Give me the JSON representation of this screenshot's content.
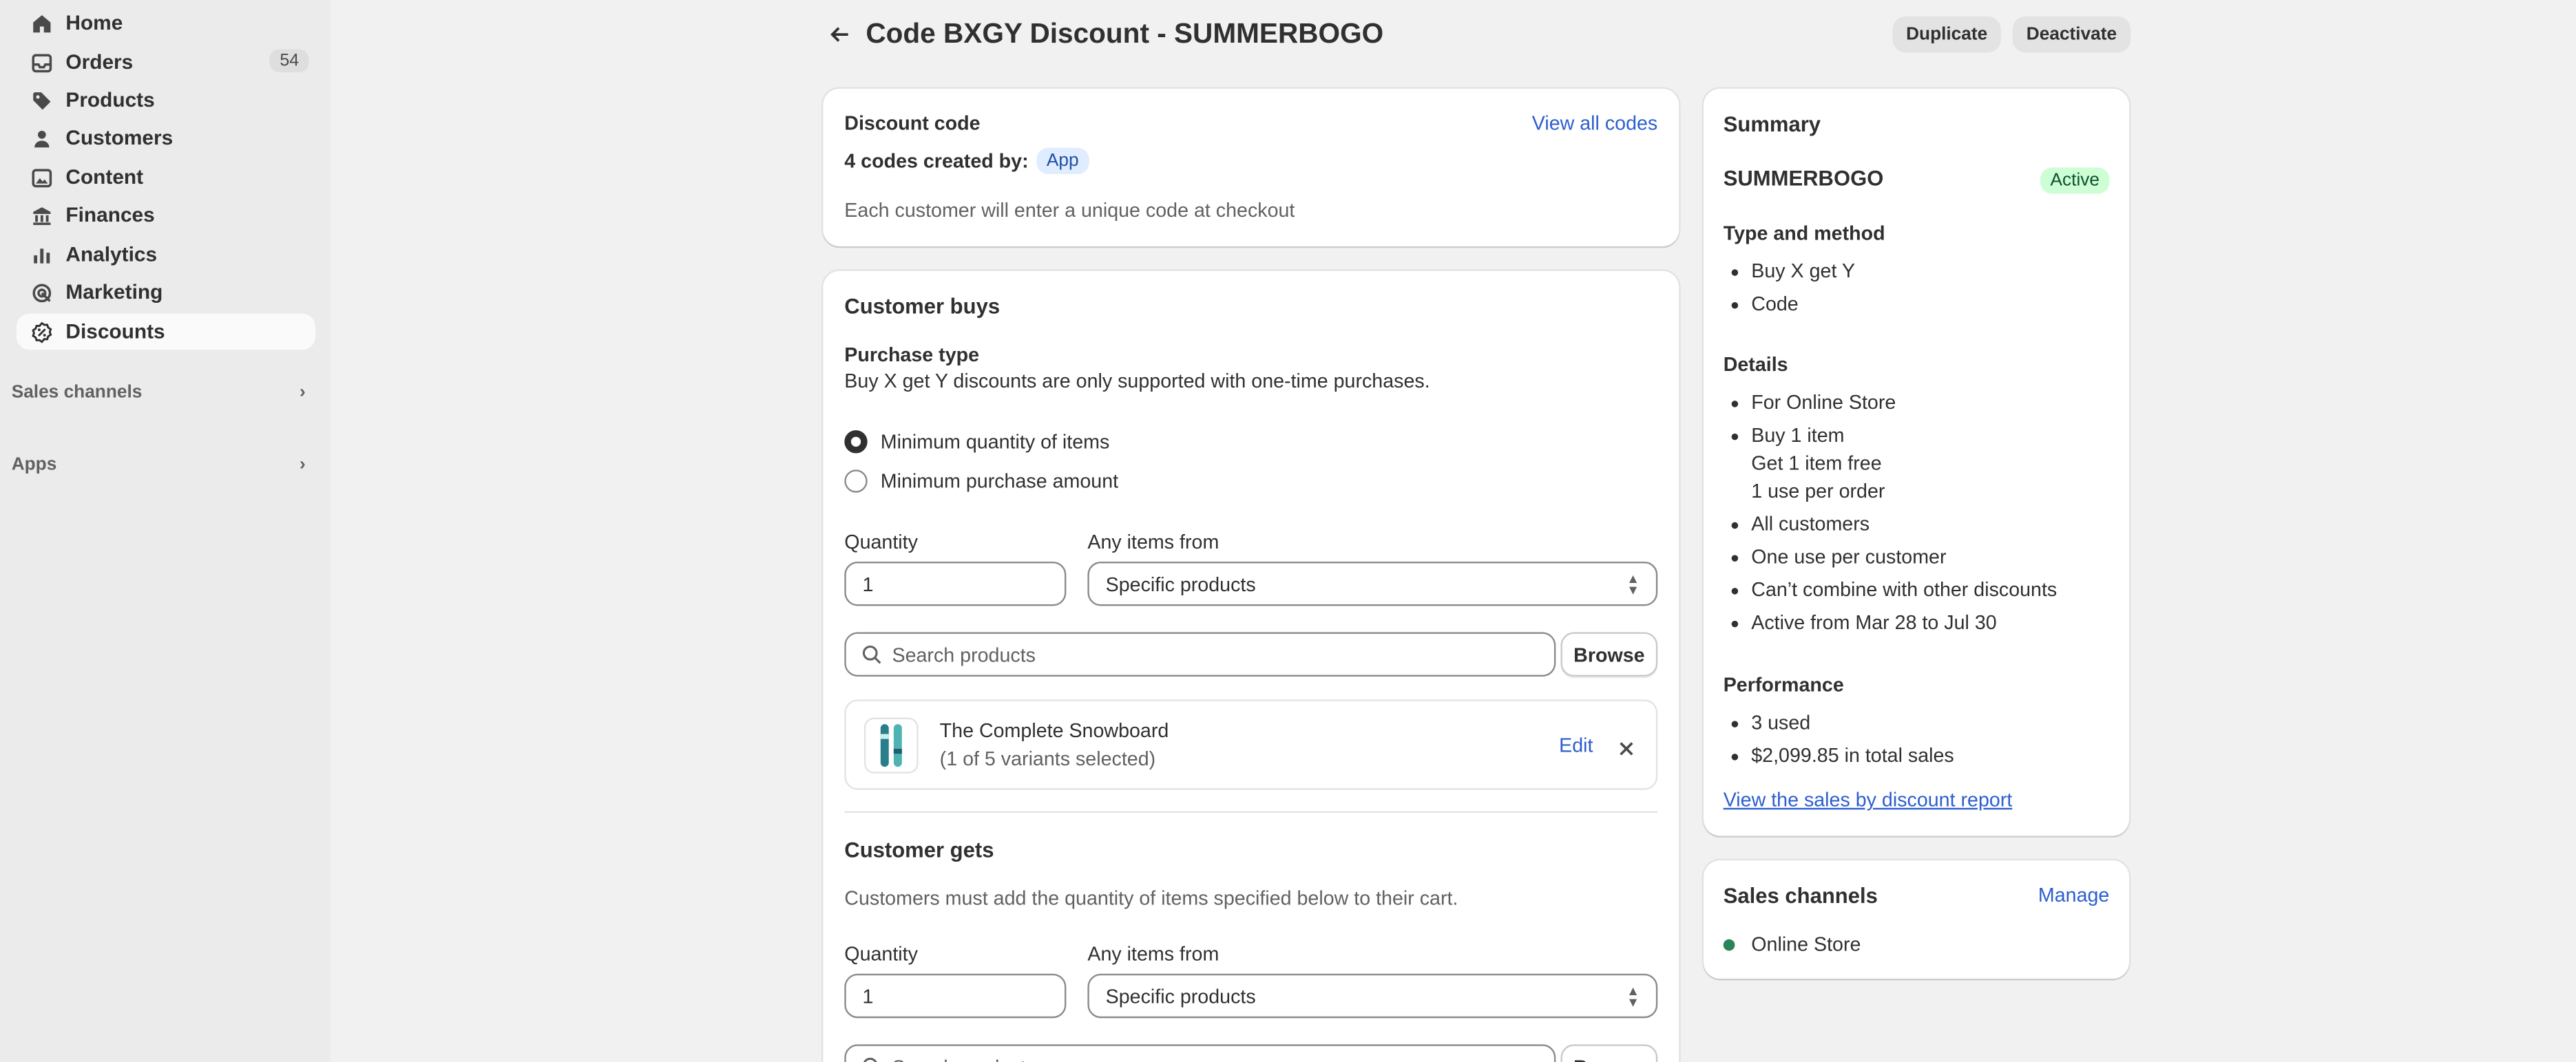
{
  "sidebar": {
    "items": [
      {
        "label": "Home",
        "icon": "home-icon"
      },
      {
        "label": "Orders",
        "icon": "inbox-icon",
        "badge": "54"
      },
      {
        "label": "Products",
        "icon": "tag-icon"
      },
      {
        "label": "Customers",
        "icon": "person-icon"
      },
      {
        "label": "Content",
        "icon": "image-icon"
      },
      {
        "label": "Finances",
        "icon": "bank-icon"
      },
      {
        "label": "Analytics",
        "icon": "bar-chart-icon"
      },
      {
        "label": "Marketing",
        "icon": "target-icon"
      },
      {
        "label": "Discounts",
        "icon": "discount-icon",
        "active": true
      }
    ],
    "sections": [
      {
        "label": "Sales channels"
      },
      {
        "label": "Apps"
      }
    ]
  },
  "header": {
    "title": "Code BXGY Discount - SUMMERBOGO",
    "duplicate_label": "Duplicate",
    "deactivate_label": "Deactivate"
  },
  "discount_code": {
    "title": "Discount code",
    "view_all_label": "View all codes",
    "codes_created": "4 codes created by:",
    "created_by": "App",
    "note": "Each customer will enter a unique code at checkout"
  },
  "customer_buys": {
    "title": "Customer buys",
    "purchase_type_label": "Purchase type",
    "purchase_type_note": "Buy X get Y discounts are only supported with one-time purchases.",
    "radio_min_qty": "Minimum quantity of items",
    "radio_min_amount": "Minimum purchase amount",
    "quantity_label": "Quantity",
    "quantity_value": "1",
    "any_items_label": "Any items from",
    "any_items_value": "Specific products",
    "search_placeholder": "Search products",
    "browse_label": "Browse",
    "product_name": "The Complete Snowboard",
    "product_variants": "(1 of 5 variants selected)",
    "edit_label": "Edit"
  },
  "customer_gets": {
    "title": "Customer gets",
    "note": "Customers must add the quantity of items specified below to their cart.",
    "quantity_label": "Quantity",
    "quantity_value": "1",
    "any_items_label": "Any items from",
    "any_items_value": "Specific products",
    "search_placeholder": "Search products",
    "browse_label": "Browse"
  },
  "summary": {
    "title": "Summary",
    "code": "SUMMERBOGO",
    "status": "Active",
    "type_heading": "Type and method",
    "type_items": [
      "Buy X get Y",
      "Code"
    ],
    "details_heading": "Details",
    "details": {
      "store": "For Online Store",
      "buy_line1": "Buy 1 item",
      "buy_line2": "Get 1 item free",
      "buy_line3": "1 use per order",
      "customers": "All customers",
      "use_limit": "One use per customer",
      "combine": "Can’t combine with other discounts",
      "active_dates": "Active from Mar 28 to Jul 30"
    },
    "performance_heading": "Performance",
    "performance_items": [
      "3 used",
      "$2,099.85 in total sales"
    ],
    "report_link": "View the sales by discount report"
  },
  "sales_channels": {
    "title": "Sales channels",
    "manage_label": "Manage",
    "channel": "Online Store"
  },
  "colors": {
    "accent_link": "#2c5ecf",
    "active_badge_bg": "#cdfed4",
    "active_badge_text": "#0c5132",
    "channel_dot": "#29845a"
  }
}
